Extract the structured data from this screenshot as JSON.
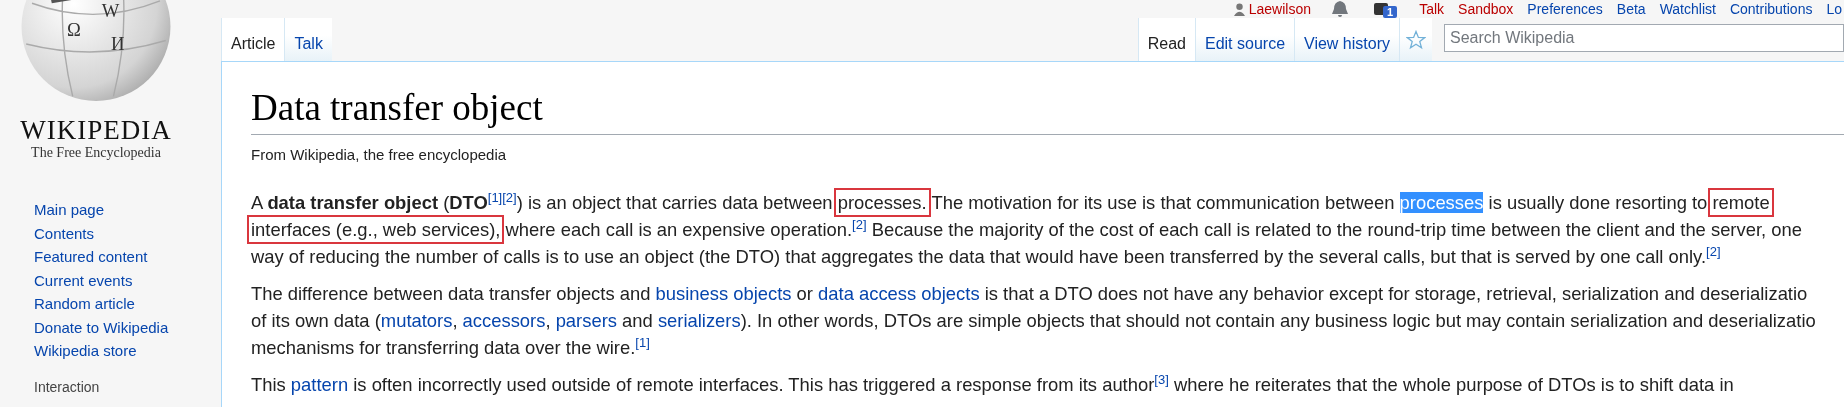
{
  "logo": {
    "glyphs": [
      "Ω",
      "W",
      "И"
    ],
    "wordmark": "WIKIPEDIA",
    "tagline": "The Free Encyclopedia"
  },
  "personal_tools": {
    "user": "Laewilson",
    "notice_count": "1",
    "links": [
      {
        "label": "Talk",
        "color": "#ba0000"
      },
      {
        "label": "Sandbox",
        "color": "#ba0000"
      },
      {
        "label": "Preferences",
        "color": "#0645ad"
      },
      {
        "label": "Beta",
        "color": "#0645ad"
      },
      {
        "label": "Watchlist",
        "color": "#0645ad"
      },
      {
        "label": "Contributions",
        "color": "#0645ad"
      },
      {
        "label": "Lo",
        "color": "#0645ad"
      }
    ]
  },
  "left_tabs": [
    {
      "label": "Article",
      "selected": true
    },
    {
      "label": "Talk",
      "selected": false
    }
  ],
  "right_tabs": [
    {
      "label": "Read",
      "selected": true
    },
    {
      "label": "Edit source",
      "selected": false
    },
    {
      "label": "View history",
      "selected": false
    }
  ],
  "search": {
    "placeholder": "Search Wikipedia"
  },
  "sidebar": {
    "items": [
      "Main page",
      "Contents",
      "Featured content",
      "Current events",
      "Random article",
      "Donate to Wikipedia",
      "Wikipedia store"
    ],
    "section": "Interaction"
  },
  "title": "Data transfer object",
  "tagline": "From Wikipedia, the free encyclopedia",
  "paragraphs": [
    {
      "lines": [
        [
          {
            "kind": "plain",
            "text": "A "
          },
          {
            "kind": "bold",
            "text": "data transfer object"
          },
          {
            "kind": "plain",
            "text": " ("
          },
          {
            "kind": "bold",
            "text": "DTO"
          },
          {
            "kind": "ref",
            "text": "[1]"
          },
          {
            "kind": "ref",
            "text": "[2]"
          },
          {
            "kind": "plain",
            "text": ") is an object that carries data between "
          },
          {
            "kind": "boxed",
            "text": "processes."
          },
          {
            "kind": "plain",
            "text": " The motivation for its use is that communication between "
          },
          {
            "kind": "selected",
            "text": "processes"
          },
          {
            "kind": "plain",
            "text": " is usually done resorting to "
          },
          {
            "kind": "boxed",
            "text": "remote"
          }
        ],
        [
          {
            "kind": "boxed",
            "text": "interfaces (e.g., web services),"
          },
          {
            "kind": "plain",
            "text": " where each call is an expensive operation."
          },
          {
            "kind": "ref",
            "text": "[2]"
          },
          {
            "kind": "plain",
            "text": " Because the majority of the cost of each call is related to the round-trip time between the client and the server, one"
          }
        ],
        [
          {
            "kind": "plain",
            "text": "way of reducing the number of calls is to use an object (the DTO) that aggregates the data that would have been transferred by the several calls, but that is served by one call only."
          },
          {
            "kind": "ref",
            "text": "[2]"
          }
        ]
      ]
    },
    {
      "lines": [
        [
          {
            "kind": "plain",
            "text": "The difference between data transfer objects and "
          },
          {
            "kind": "link",
            "text": "business objects"
          },
          {
            "kind": "plain",
            "text": " or "
          },
          {
            "kind": "link",
            "text": "data access objects"
          },
          {
            "kind": "plain",
            "text": " is that a DTO does not have any behavior except for storage, retrieval, serialization and deserializatio"
          }
        ],
        [
          {
            "kind": "plain",
            "text": "of its own data ("
          },
          {
            "kind": "link",
            "text": "mutators"
          },
          {
            "kind": "plain",
            "text": ", "
          },
          {
            "kind": "link",
            "text": "accessors"
          },
          {
            "kind": "plain",
            "text": ", "
          },
          {
            "kind": "link",
            "text": "parsers"
          },
          {
            "kind": "plain",
            "text": " and "
          },
          {
            "kind": "link",
            "text": "serializers"
          },
          {
            "kind": "plain",
            "text": "). In other words, DTOs are simple objects that should not contain any business logic but may contain serialization and deserializatio"
          }
        ],
        [
          {
            "kind": "plain",
            "text": "mechanisms for transferring data over the wire."
          },
          {
            "kind": "ref",
            "text": "[1]"
          }
        ]
      ]
    },
    {
      "lines": [
        [
          {
            "kind": "plain",
            "text": "This "
          },
          {
            "kind": "link",
            "text": "pattern"
          },
          {
            "kind": "plain",
            "text": " is often incorrectly used outside of remote interfaces. This has triggered a response from its author"
          },
          {
            "kind": "ref",
            "text": "[3]"
          },
          {
            "kind": "plain",
            "text": " where he reiterates that the whole purpose of DTOs is to shift data in"
          }
        ]
      ]
    }
  ]
}
